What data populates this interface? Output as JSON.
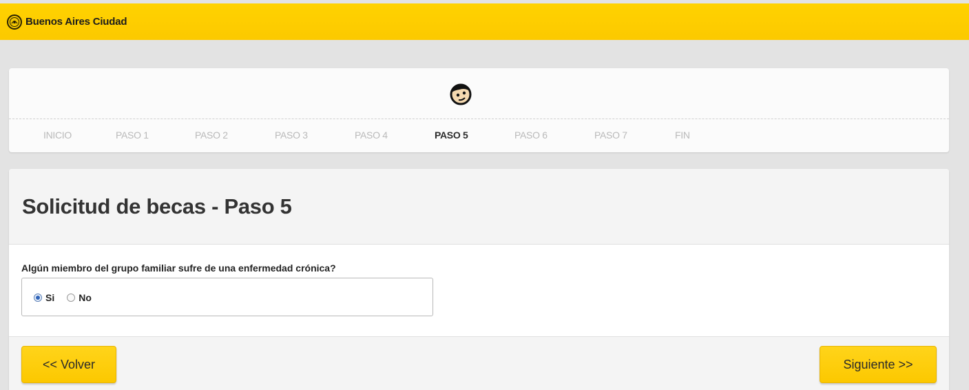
{
  "header": {
    "brand": "Buenos Aires Ciudad",
    "logo_icon": "city-seal-icon",
    "color": "#fdcf00"
  },
  "stepper": {
    "avatar_icon": "smiley-face-icon",
    "steps": [
      {
        "label": "INICIO",
        "active": false
      },
      {
        "label": "PASO 1",
        "active": false
      },
      {
        "label": "PASO 2",
        "active": false
      },
      {
        "label": "PASO 3",
        "active": false
      },
      {
        "label": "PASO 4",
        "active": false
      },
      {
        "label": "PASO 5",
        "active": true
      },
      {
        "label": "PASO 6",
        "active": false
      },
      {
        "label": "PASO 7",
        "active": false
      },
      {
        "label": "FIN",
        "active": false
      }
    ]
  },
  "form": {
    "title": "Solicitud de becas - Paso 5",
    "question": "Algún miembro del grupo familiar sufre de una enfermedad crónica?",
    "options": [
      {
        "label": "Si",
        "checked": true
      },
      {
        "label": "No",
        "checked": false
      }
    ]
  },
  "footer": {
    "back_label": "<< Volver",
    "next_label": "Siguiente >>"
  }
}
